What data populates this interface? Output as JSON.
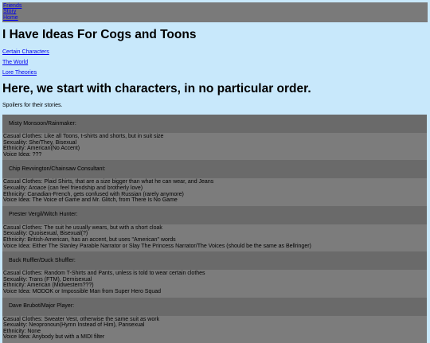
{
  "nav": {
    "friends": "Friends",
    "story": "Story",
    "home": "Home"
  },
  "title": "I Have Ideas For Cogs and Toons",
  "sublinks": {
    "characters": "Certain Characters",
    "world": "The World",
    "lore": "Lore Theories"
  },
  "section_heading": "Here, we start with characters, in no particular order.",
  "intro": "Spoilers for their stories.",
  "characters": [
    {
      "name": "Misty Monsoon/Rainmaker:",
      "lines": [
        "Casual Clothes: Like all Toons, t-shirts and shorts, but in suit size",
        "Sexuality: She/They, Bisexual",
        "Ethnicity: American(No Accent)",
        "Voice Idea: ???"
      ]
    },
    {
      "name": "Chip Revvington/Chainsaw Consultant:",
      "lines": [
        "Casual Clothes: Plaid Shirts, that are a size bigger than what he can wear, and Jeans",
        "Sexuality: Aroace (can feel friendship and brotherly love)",
        "Ethnicity: Canadian-French, gets confused with Russian (rarely anymore)",
        "Voice Idea: The Voice of Game and Mr. Glitch, from There Is No Game"
      ]
    },
    {
      "name": "Prester Vergil/Witch Hunter:",
      "lines": [
        "Casual Clothes: The suit he usually wears, but with a short cloak",
        "Sexuality: Quoisexual, Bisexual(?)",
        "Ethnicity: British-American, has an accent, but uses \"American\" words",
        "Voice Idea: Either The Stanley Parable Narrator or Slay The Princess Narrator/The Voices (should be the same as Bellringer)"
      ]
    },
    {
      "name": "Buck Ruffler/Duck Shuffler:",
      "lines": [
        "Casual Clothes: Random T-Shirts and Pants, unless is told to wear certain clothes",
        "Sexuality: Trans (FTM), Demisexual",
        "Ethnicity: American (Midwestern???)",
        "Voice Idea: MODOK or Impossible Man from Super Hero Squad"
      ]
    },
    {
      "name": "Dave Brubot/Major Player:",
      "lines": [
        "Casual Clothes: Sweater Vest, otherwise the same suit as work",
        "Sexuality: Neopronoun(Hymn Instead of Him), Pansexual",
        "Ethnicity: None",
        "Voice Idea: Anybody but with a MIDI filter"
      ]
    }
  ]
}
